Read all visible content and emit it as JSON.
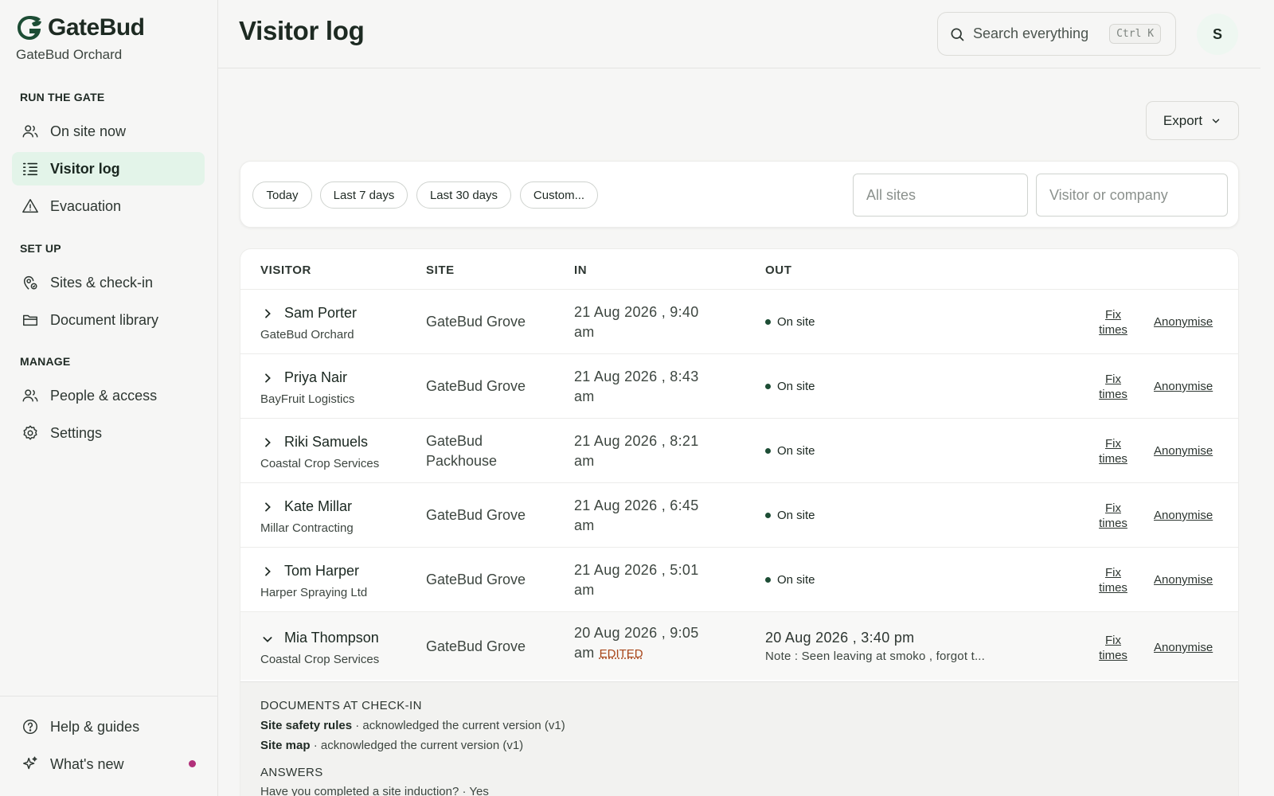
{
  "app": {
    "name": "GateBud",
    "org": "GateBud Orchard"
  },
  "sidebar": {
    "sections": [
      {
        "label": "RUN THE GATE",
        "items": [
          {
            "label": "On site now",
            "icon": "people-icon"
          },
          {
            "label": "Visitor log",
            "icon": "list-icon",
            "active": true
          },
          {
            "label": "Evacuation",
            "icon": "warning-icon"
          }
        ]
      },
      {
        "label": "SET UP",
        "items": [
          {
            "label": "Sites & check-in",
            "icon": "location-pin-icon"
          },
          {
            "label": "Document library",
            "icon": "folder-icon"
          }
        ]
      },
      {
        "label": "MANAGE",
        "items": [
          {
            "label": "People & access",
            "icon": "people-icon"
          },
          {
            "label": "Settings",
            "icon": "gear-icon"
          }
        ]
      }
    ],
    "bottom": [
      {
        "label": "Help & guides",
        "icon": "help-circle-icon"
      },
      {
        "label": "What's new",
        "icon": "sparkle-icon",
        "badge_color": "#b1307a"
      }
    ]
  },
  "header": {
    "title": "Visitor log",
    "search_placeholder": "Search everything",
    "search_shortcut": "Ctrl K",
    "avatar_initial": "S"
  },
  "toolbar": {
    "export_label": "Export"
  },
  "filters": {
    "chips": [
      "Today",
      "Last 7 days",
      "Last 30 days",
      "Custom..."
    ],
    "site_placeholder": "All sites",
    "visitor_placeholder": "Visitor or company"
  },
  "table": {
    "columns": [
      "VISITOR",
      "SITE",
      "IN",
      "OUT"
    ],
    "rows": [
      {
        "name": "Sam Porter",
        "company": "GateBud Orchard",
        "site": "GateBud Grove",
        "in_date": "21 Aug 2026 , 9:40",
        "in_ampm": "am",
        "status": "On site"
      },
      {
        "name": "Priya Nair",
        "company": "BayFruit Logistics",
        "site": "GateBud Grove",
        "in_date": "21 Aug 2026 , 8:43",
        "in_ampm": "am",
        "status": "On site"
      },
      {
        "name": "Riki Samuels",
        "company": "Coastal Crop Services",
        "site": "GateBud Packhouse",
        "in_date": "21 Aug 2026 , 8:21",
        "in_ampm": "am",
        "status": "On site"
      },
      {
        "name": "Kate Millar",
        "company": "Millar Contracting",
        "site": "GateBud Grove",
        "in_date": "21 Aug 2026 , 6:45",
        "in_ampm": "am",
        "status": "On site"
      },
      {
        "name": "Tom Harper",
        "company": "Harper Spraying Ltd",
        "site": "GateBud Grove",
        "in_date": "21 Aug 2026 , 5:01",
        "in_ampm": "am",
        "status": "On site"
      },
      {
        "name": "Mia Thompson",
        "company": "Coastal Crop Services",
        "site": "GateBud Grove",
        "in_date": "20 Aug 2026 , 9:05",
        "in_ampm": "am",
        "edited_label": "EDITED",
        "out_time": "20 Aug 2026 , 3:40 pm",
        "out_note": "Note : Seen leaving at smoko , forgot t..."
      }
    ],
    "fix_label_1": "Fix",
    "fix_label_2": "times",
    "anonymise_label": "Anonymise",
    "status_color": "#1d4d35"
  },
  "detail": {
    "documents_heading": "DOCUMENTS AT CHECK-IN",
    "documents": [
      {
        "name": "Site safety rules",
        "text": " · acknowledged the current version (v1)"
      },
      {
        "name": "Site map",
        "text": " · acknowledged the current version (v1)"
      }
    ],
    "answers_heading": "ANSWERS",
    "answers": [
      {
        "text": "Have you completed a site induction? · Yes"
      }
    ]
  },
  "colors": {
    "accent": "#1d4d35",
    "active_nav_bg": "#e3f4e9"
  }
}
